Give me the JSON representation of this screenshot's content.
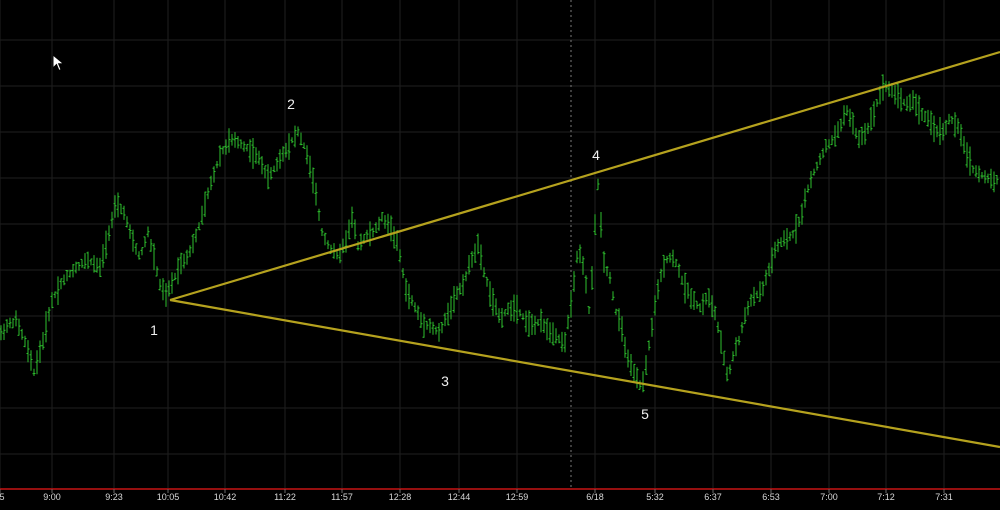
{
  "chart_data": {
    "type": "bar",
    "subtype": "ohlc",
    "x_tick_labels": [
      "5",
      "9:00",
      "9:23",
      "10:05",
      "10:42",
      "11:22",
      "11:57",
      "12:28",
      "12:44",
      "12:59",
      "6/18",
      "5:32",
      "6:37",
      "6:53",
      "7:00",
      "7:12",
      "7:31"
    ],
    "session_break_label": "6/18",
    "price_path": [
      [
        0,
        335
      ],
      [
        8,
        325
      ],
      [
        16,
        320
      ],
      [
        25,
        342
      ],
      [
        34,
        372
      ],
      [
        42,
        345
      ],
      [
        52,
        300
      ],
      [
        62,
        282
      ],
      [
        75,
        268
      ],
      [
        88,
        260
      ],
      [
        100,
        268
      ],
      [
        108,
        235
      ],
      [
        116,
        205
      ],
      [
        124,
        212
      ],
      [
        132,
        240
      ],
      [
        140,
        258
      ],
      [
        148,
        232
      ],
      [
        154,
        258
      ],
      [
        160,
        285
      ],
      [
        166,
        296
      ],
      [
        172,
        283
      ],
      [
        180,
        265
      ],
      [
        188,
        255
      ],
      [
        195,
        240
      ],
      [
        203,
        212
      ],
      [
        212,
        180
      ],
      [
        220,
        155
      ],
      [
        230,
        140
      ],
      [
        240,
        143
      ],
      [
        250,
        150
      ],
      [
        260,
        160
      ],
      [
        268,
        178
      ],
      [
        276,
        166
      ],
      [
        284,
        152
      ],
      [
        292,
        140
      ],
      [
        298,
        132
      ],
      [
        306,
        150
      ],
      [
        314,
        185
      ],
      [
        322,
        232
      ],
      [
        330,
        248
      ],
      [
        338,
        256
      ],
      [
        346,
        240
      ],
      [
        352,
        218
      ],
      [
        358,
        245
      ],
      [
        366,
        236
      ],
      [
        374,
        232
      ],
      [
        382,
        218
      ],
      [
        390,
        226
      ],
      [
        398,
        245
      ],
      [
        406,
        290
      ],
      [
        414,
        305
      ],
      [
        422,
        322
      ],
      [
        430,
        326
      ],
      [
        440,
        334
      ],
      [
        448,
        312
      ],
      [
        456,
        295
      ],
      [
        464,
        282
      ],
      [
        472,
        258
      ],
      [
        478,
        245
      ],
      [
        484,
        272
      ],
      [
        492,
        300
      ],
      [
        500,
        318
      ],
      [
        508,
        310
      ],
      [
        516,
        306
      ],
      [
        524,
        318
      ],
      [
        532,
        326
      ],
      [
        540,
        322
      ],
      [
        548,
        330
      ],
      [
        556,
        334
      ],
      [
        564,
        346
      ],
      [
        572,
        300
      ],
      [
        578,
        248
      ],
      [
        584,
        270
      ],
      [
        590,
        318
      ],
      [
        594,
        238
      ],
      [
        598,
        185
      ],
      [
        604,
        262
      ],
      [
        610,
        278
      ],
      [
        616,
        312
      ],
      [
        622,
        330
      ],
      [
        628,
        360
      ],
      [
        634,
        375
      ],
      [
        642,
        388
      ],
      [
        650,
        340
      ],
      [
        656,
        300
      ],
      [
        662,
        272
      ],
      [
        668,
        256
      ],
      [
        676,
        262
      ],
      [
        684,
        286
      ],
      [
        692,
        298
      ],
      [
        700,
        308
      ],
      [
        708,
        296
      ],
      [
        716,
        316
      ],
      [
        722,
        350
      ],
      [
        728,
        378
      ],
      [
        734,
        352
      ],
      [
        740,
        338
      ],
      [
        746,
        310
      ],
      [
        754,
        296
      ],
      [
        762,
        292
      ],
      [
        768,
        272
      ],
      [
        776,
        248
      ],
      [
        784,
        240
      ],
      [
        792,
        236
      ],
      [
        800,
        220
      ],
      [
        808,
        188
      ],
      [
        816,
        168
      ],
      [
        824,
        150
      ],
      [
        832,
        140
      ],
      [
        840,
        128
      ],
      [
        846,
        108
      ],
      [
        852,
        122
      ],
      [
        858,
        140
      ],
      [
        866,
        132
      ],
      [
        872,
        118
      ],
      [
        878,
        100
      ],
      [
        884,
        84
      ],
      [
        890,
        90
      ],
      [
        898,
        96
      ],
      [
        906,
        104
      ],
      [
        914,
        100
      ],
      [
        920,
        112
      ],
      [
        926,
        118
      ],
      [
        934,
        128
      ],
      [
        942,
        134
      ],
      [
        950,
        118
      ],
      [
        958,
        128
      ],
      [
        966,
        150
      ],
      [
        972,
        168
      ],
      [
        980,
        175
      ],
      [
        988,
        178
      ],
      [
        996,
        180
      ]
    ],
    "trendlines": [
      {
        "name": "upper",
        "from": [
          170,
          300
        ],
        "to": [
          1000,
          52
        ]
      },
      {
        "name": "lower",
        "from": [
          170,
          300
        ],
        "to": [
          1000,
          447
        ]
      }
    ],
    "pivot_labels": [
      "1",
      "2",
      "3",
      "4",
      "5"
    ],
    "grid": true,
    "colors": {
      "background": "#000000",
      "bars": "#2ec02e",
      "trendline": "#b5a21e",
      "grid": "#1f1f1f",
      "axis_text": "#d8d8d8",
      "pivot_text": "#f0f0f0",
      "bottom_rule": "#c81414",
      "divider": "#7a7a7a"
    }
  },
  "cursor_icon": "arrow-pointer-icon"
}
